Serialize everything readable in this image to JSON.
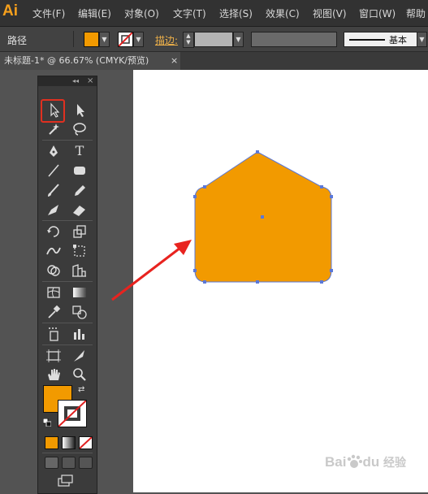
{
  "app": {
    "logo": "Ai"
  },
  "menu": [
    "文件(F)",
    "编辑(E)",
    "对象(O)",
    "文字(T)",
    "选择(S)",
    "效果(C)",
    "视图(V)",
    "窗口(W)",
    "帮助"
  ],
  "control_bar": {
    "selection_label": "路径",
    "stroke_label": "描边:",
    "brush_style_label": "基本",
    "fill_color": "#f29a00",
    "stroke_color": "none"
  },
  "document_tab": {
    "title": "未标题-1* @ 66.67% (CMYK/预览)",
    "close_glyph": "×"
  },
  "toolbox": {
    "header_collapse_glyph": "◂◂",
    "header_close_glyph": "×",
    "selected_tool": "selection-tool",
    "type_tool_glyph": "T",
    "fill_color": "#f29a00",
    "stroke_color": "none"
  },
  "canvas": {
    "shape": "pentagon-house",
    "shape_fill": "#f29a00",
    "selection_color": "#5b78d8",
    "annotation_arrow_color": "#e8231f",
    "highlight_color": "#e03020"
  },
  "watermark": {
    "text": "Baidu 经验",
    "brand": "Bai",
    "brand2": "du",
    "suffix": "经验"
  }
}
